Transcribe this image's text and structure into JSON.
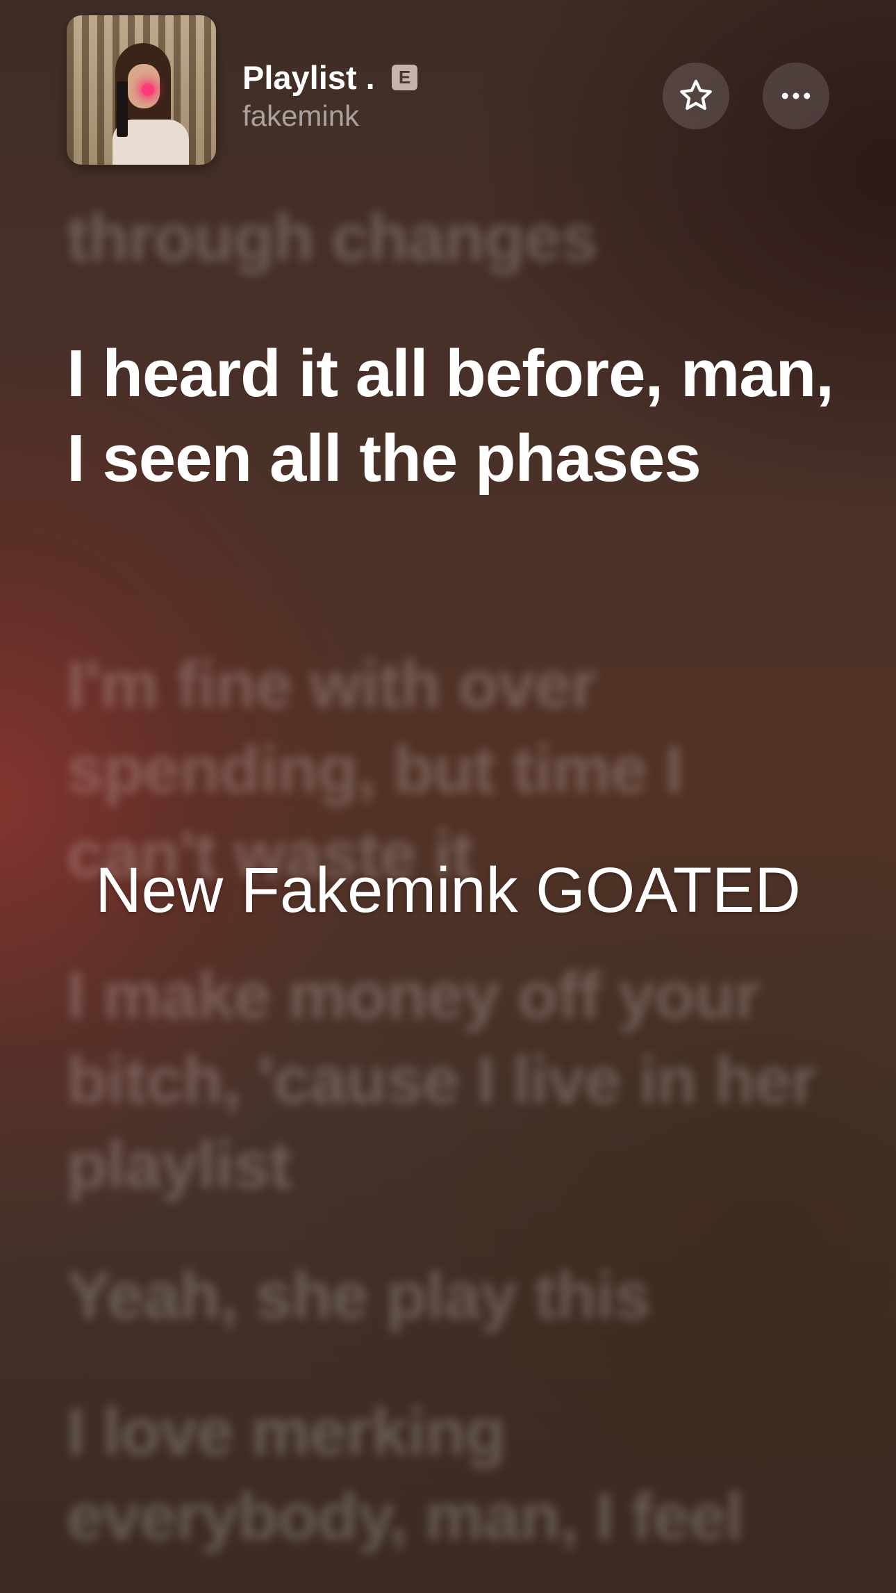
{
  "header": {
    "track_title": "Playlist .",
    "explicit_badge": "E",
    "artist": "fakemink",
    "favorite_icon": "star-icon",
    "more_icon": "ellipsis-icon"
  },
  "lyrics": {
    "previous": "through changes",
    "current": "I heard it all before, man, I seen all the phases",
    "upcoming": [
      "I'm fine with over spending, but time I can't waste it",
      "I make money off your bitch, 'cause I live in her playlist",
      "Yeah, she play this",
      "I love merking everybody, man, I feel"
    ]
  },
  "overlay": {
    "caption": "New Fakemink GOATED"
  },
  "colors": {
    "active_lyric": "#ffffff",
    "dim_lyric": "rgba(255,255,255,0.22)",
    "background_red": "#8c3430",
    "background_brown": "#4a3128"
  }
}
